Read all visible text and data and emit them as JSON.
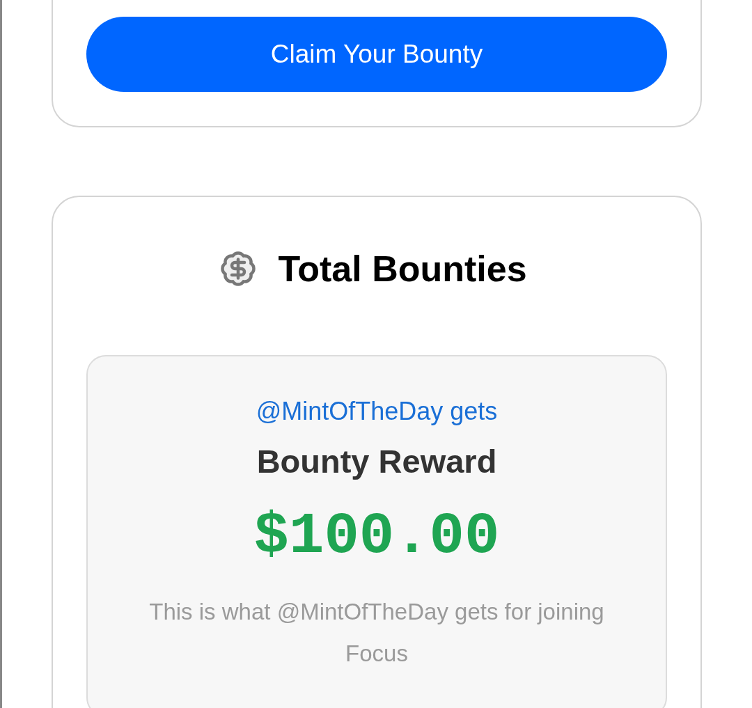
{
  "claim_card": {
    "button": {
      "label": "Claim Your Bounty"
    }
  },
  "total_bounties": {
    "title": "Total Bounties",
    "reward": {
      "recipient_line": "@MintOfTheDay gets",
      "title": "Bounty Reward",
      "amount": "$100.00",
      "description": "This is what @MintOfTheDay gets for joining Focus"
    }
  }
}
